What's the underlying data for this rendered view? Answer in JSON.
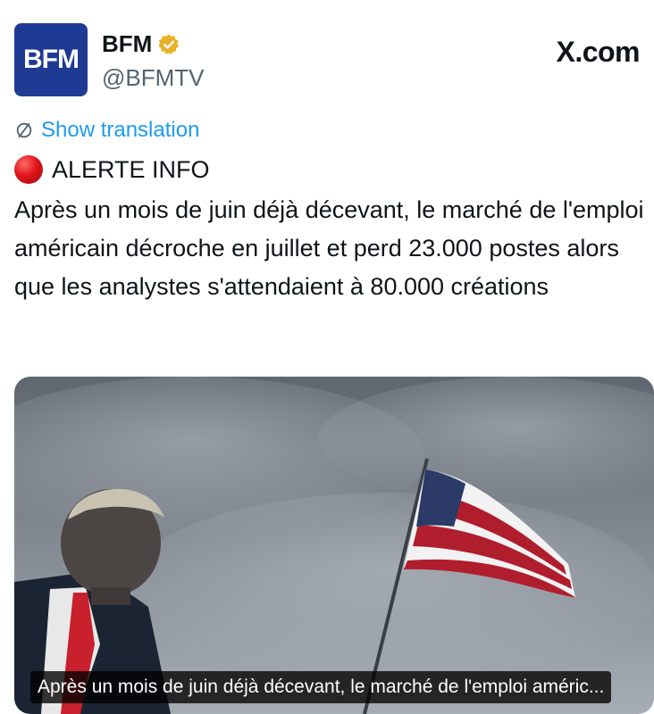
{
  "account": {
    "avatar_text": "BFM",
    "display_name": "BFM",
    "handle": "@BFMTV",
    "verified_badge_color": "#e8b229"
  },
  "site_label": "X.com",
  "translation": {
    "label": "Show translation",
    "icon": "translate-icon",
    "color": "#1d9bf0"
  },
  "alert": {
    "icon": "red-circle-icon",
    "label": "ALERTE INFO"
  },
  "post_text": "Après un mois de juin déjà décevant, le marché de l'emploi américain décroche en juillet et perd 23.000 postes alors que les analystes s'attendaient à 80.000 créations",
  "media": {
    "caption": "Après un mois de juin déjà décevant, le marché de l'emploi améric..."
  }
}
